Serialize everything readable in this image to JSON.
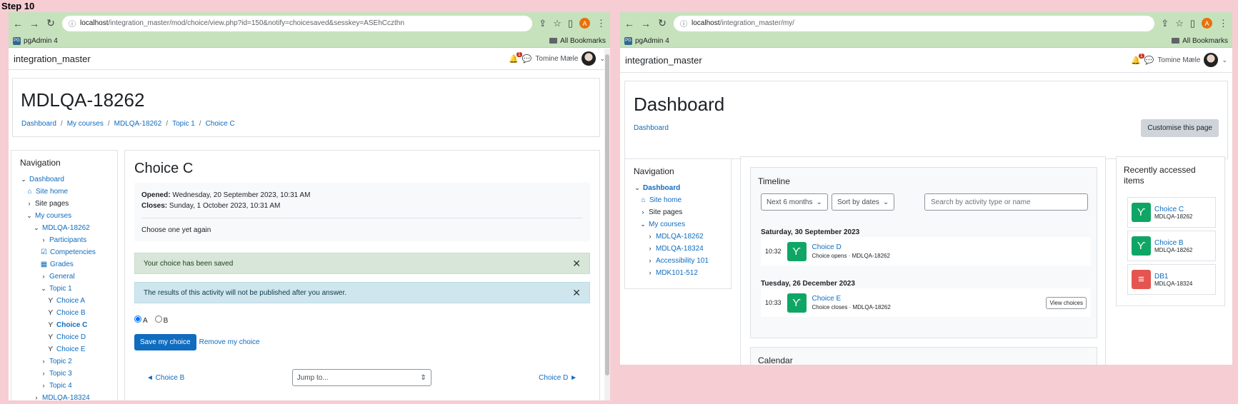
{
  "step_label": "Step 10",
  "left": {
    "url_host": "localhost",
    "url_path": "/integration_master/mod/choice/view.php?id=150&notify=choicesaved&sesskey=ASEhCczthn",
    "bookmark": "pgAdmin 4",
    "bookmark_icon": "PG",
    "all_bookmarks": "All Bookmarks",
    "profile_initial": "A",
    "site_name": "integration_master",
    "notif_count": "1",
    "user_name": "Tomine Mæle",
    "page_title": "MDLQA-18262",
    "breadcrumb": [
      "Dashboard",
      "My courses",
      "MDLQA-18262",
      "Topic 1",
      "Choice C"
    ],
    "nav_title": "Navigation",
    "nav": {
      "dashboard": "Dashboard",
      "site_home": "Site home",
      "site_pages": "Site pages",
      "my_courses": "My courses",
      "course": "MDLQA-18262",
      "participants": "Participants",
      "competencies": "Competencies",
      "grades": "Grades",
      "general": "General",
      "topic1": "Topic 1",
      "choices": [
        "Choice A",
        "Choice B",
        "Choice C",
        "Choice D",
        "Choice E"
      ],
      "topic2": "Topic 2",
      "topic3": "Topic 3",
      "topic4": "Topic 4",
      "course2": "MDLQA-18324"
    },
    "activity_title": "Choice C",
    "opened_label": "Opened:",
    "opened_value": "Wednesday, 20 September 2023, 10:31 AM",
    "closes_label": "Closes:",
    "closes_value": "Sunday, 1 October 2023, 10:31 AM",
    "description": "Choose one yet again",
    "alert_saved": "Your choice has been saved",
    "alert_info": "The results of this activity will not be published after you answer.",
    "option_a": "A",
    "option_b": "B",
    "selected_option": "A",
    "save_btn": "Save my choice",
    "remove_link": "Remove my choice",
    "prev_link": "◄ Choice B",
    "jump_to": "Jump to...",
    "next_link": "Choice D ►"
  },
  "right": {
    "url_host": "localhost",
    "url_path": "/integration_master/my/",
    "bookmark": "pgAdmin 4",
    "bookmark_icon": "PG",
    "all_bookmarks": "All Bookmarks",
    "profile_initial": "A",
    "site_name": "integration_master",
    "notif_count": "1",
    "user_name": "Tomine Mæle",
    "page_title": "Dashboard",
    "breadcrumb": "Dashboard",
    "customise_btn": "Customise this page",
    "nav_title": "Navigation",
    "nav": {
      "dashboard": "Dashboard",
      "site_home": "Site home",
      "site_pages": "Site pages",
      "my_courses": "My courses",
      "courses": [
        "MDLQA-18262",
        "MDLQA-18324",
        "Accessibility 101",
        "MDK101-512"
      ]
    },
    "timeline_title": "Timeline",
    "filter_range": "Next 6 months",
    "sort": "Sort by dates",
    "search_placeholder": "Search by activity type or name",
    "day1": "Saturday, 30 September 2023",
    "ev1_time": "10:32",
    "ev1_name": "Choice D",
    "ev1_sub": "Choice opens · MDLQA-18262",
    "day2": "Tuesday, 26 December 2023",
    "ev2_time": "10:33",
    "ev2_name": "Choice E",
    "ev2_sub": "Choice closes · MDLQA-18262",
    "view_choices_btn": "View choices",
    "calendar_title": "Calendar",
    "recent_title": "Recently accessed items",
    "recent": [
      {
        "name": "Choice C",
        "course": "MDLQA-18262"
      },
      {
        "name": "Choice B",
        "course": "MDLQA-18262"
      },
      {
        "name": "DB1",
        "course": "MDLQA-18324"
      }
    ]
  }
}
